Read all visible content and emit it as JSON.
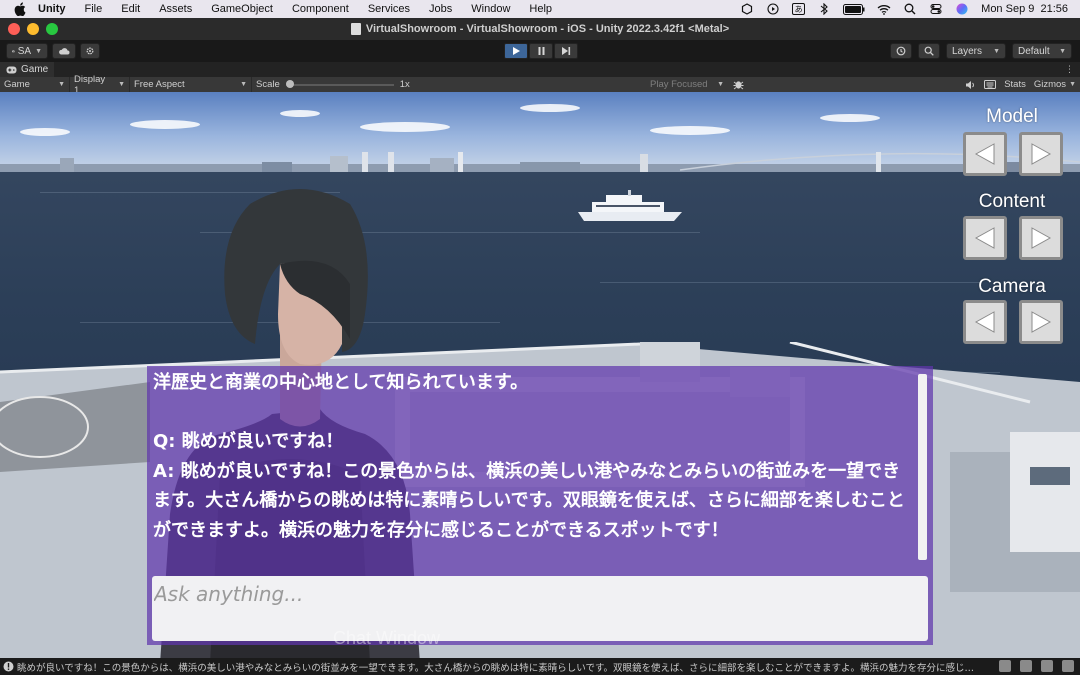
{
  "menubar": {
    "apple_icon": "apple-logo",
    "items": [
      "Unity",
      "File",
      "Edit",
      "Assets",
      "GameObject",
      "Component",
      "Services",
      "Jobs",
      "Window",
      "Help"
    ],
    "status_icons": [
      "unity-icon",
      "play-circle-icon",
      "input-method-icon",
      "bluetooth-icon",
      "battery-icon",
      "wifi-icon",
      "search-icon",
      "control-center-icon",
      "siri-icon"
    ],
    "input_method": "あ",
    "datetime": "Mon Sep 9  21:56"
  },
  "window": {
    "title": "VirtualShowroom - VirtualShowroom - iOS - Unity 2022.3.42f1 <Metal>",
    "traffic_colors": [
      "#fe5f57",
      "#febc2e",
      "#28c840"
    ]
  },
  "toolbar": {
    "account_label": "SA",
    "layers_label": "Layers",
    "layout_label": "Default"
  },
  "game_tab": {
    "tab_label": "Game",
    "mode_dropdown": "Game",
    "display_dropdown": "Display 1",
    "aspect_dropdown": "Free Aspect",
    "scale_label": "Scale",
    "scale_value": "1x",
    "scale_level": 0,
    "play_focused_dropdown": "Play Focused",
    "stats_label": "Stats",
    "gizmos_label": "Gizmos"
  },
  "controls": {
    "model_label": "Model",
    "content_label": "Content",
    "camera_label": "Camera"
  },
  "chat": {
    "text": "洋歴史と商業の中心地として知られています。\n\nQ: 眺めが良いですね！\nA: 眺めが良いですね！この景色からは、横浜の美しい港やみなとみらいの街並みを一望できます。大さん橋からの眺めは特に素晴らしいです。双眼鏡を使えば、さらに細部を楽しむことができますよ。横浜の魅力を存分に感じることができるスポットです！",
    "input_placeholder": "Ask anything...",
    "window_label": "Chat Window",
    "panel_color": "#6036ac"
  },
  "statusbar": {
    "message": "眺めが良いですね！この景色からは、横浜の美しい港やみなとみらいの街並みを一望できます。大さん橋からの眺めは特に素晴らしいです。双眼鏡を使えば、さらに細部を楽しむことができますよ。横浜の魅力を存分に感じることができるスポットです！"
  }
}
